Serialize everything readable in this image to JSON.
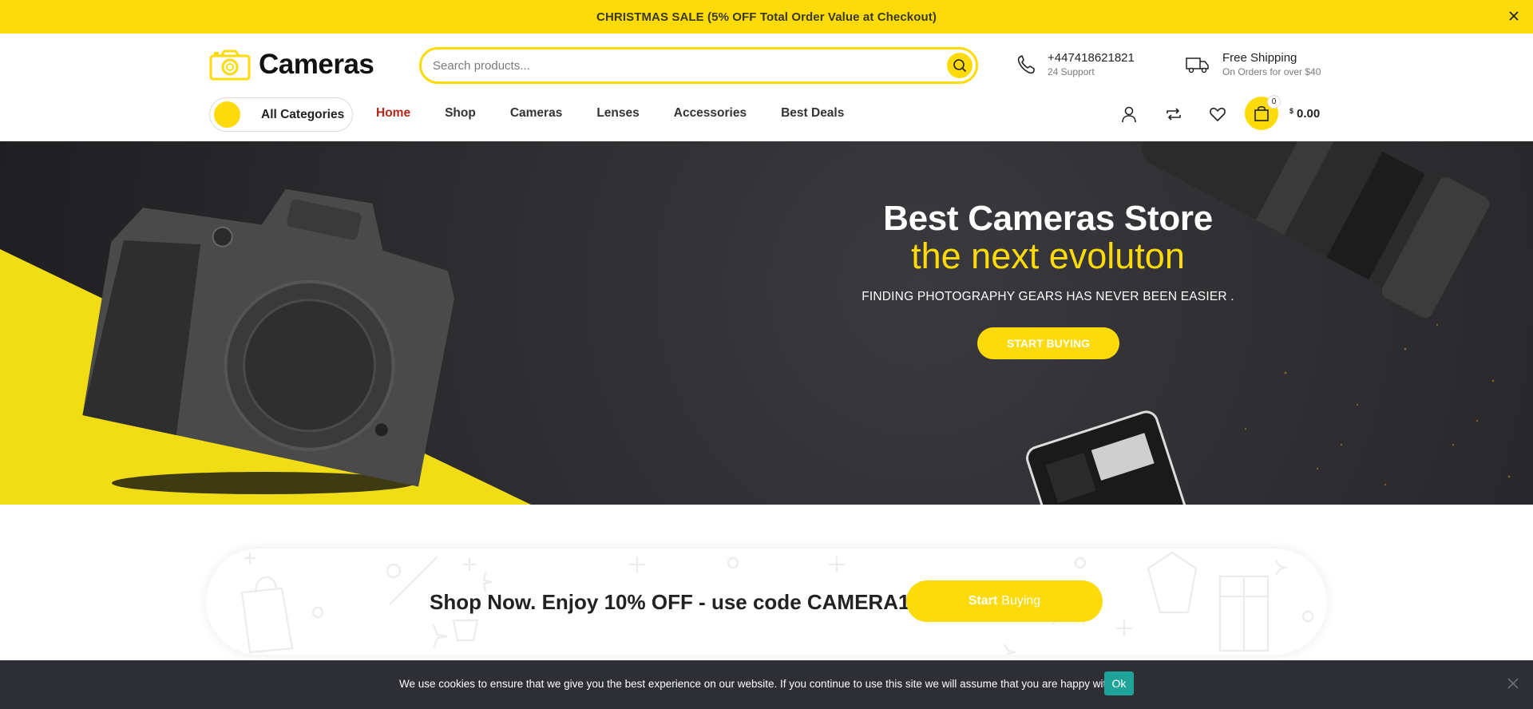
{
  "announcement": {
    "text": "CHRISTMAS SALE (5% OFF Total Order Value at Checkout)",
    "close_icon": "close-icon"
  },
  "header": {
    "logo_text": "Cameras",
    "logo_icon": "camera-icon",
    "search_placeholder": "Search products...",
    "search_icon": "search-icon",
    "phone": {
      "number": "+447418621821",
      "label": "24 Support",
      "icon": "phone-icon"
    },
    "shipping": {
      "title": "Free Shipping",
      "label": "On Orders for over $40",
      "icon": "truck-icon"
    }
  },
  "nav": {
    "categories_label": "All Categories",
    "items": [
      {
        "label": "Home",
        "active": true
      },
      {
        "label": "Shop",
        "active": false
      },
      {
        "label": "Cameras",
        "active": false
      },
      {
        "label": "Lenses",
        "active": false
      },
      {
        "label": "Accessories",
        "active": false
      },
      {
        "label": "Best Deals",
        "active": false
      }
    ],
    "icons": [
      "user-icon",
      "compare-icon",
      "heart-icon",
      "cart-icon"
    ],
    "cart_count": "0",
    "cart_currency": "$",
    "cart_total": "0.00"
  },
  "hero": {
    "title": "Best Cameras Store",
    "subtitle": "the next evoluton",
    "tagline": "FINDING PHOTOGRAPHY GEARS HAS NEVER BEEN EASIER .",
    "button": "START BUYING"
  },
  "promo": {
    "text": "Shop Now. Enjoy 10% OFF - use code CAMERA10",
    "button_bold": "Start",
    "button_rest": "Buying"
  },
  "cookie": {
    "text": "We use cookies to ensure that we give you the best experience on our website. If you continue to use this site we will assume that you are happy with it.",
    "ok": "Ok",
    "close_icon": "close-icon"
  },
  "colors": {
    "accent": "#fddb0a",
    "active_nav": "#b4261a",
    "hero_bg": "#2a292c",
    "cookie_bg": "#2d2f35",
    "cookie_ok": "#1fa398"
  }
}
